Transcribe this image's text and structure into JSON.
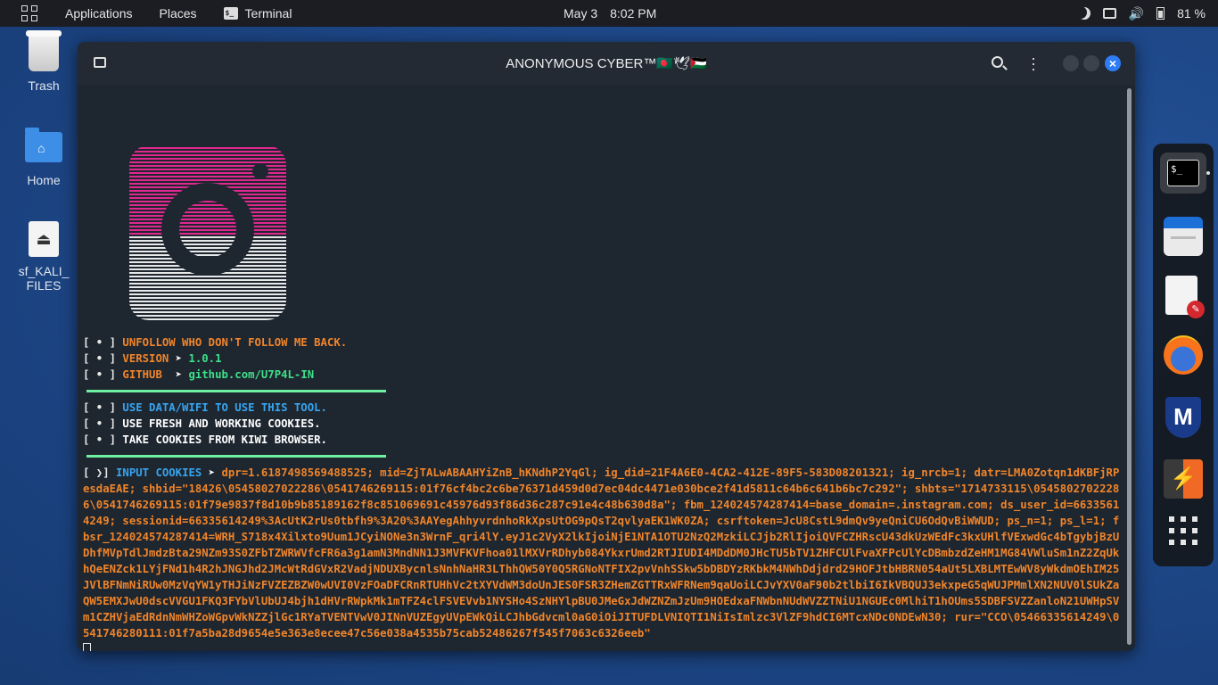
{
  "topbar": {
    "applications": "Applications",
    "places": "Places",
    "terminal": "Terminal",
    "date": "May 3",
    "time": "8:02 PM",
    "battery": "81 %"
  },
  "desktop": {
    "trash": "Trash",
    "home": "Home",
    "sf_line1": "sf_KALI_",
    "sf_line2": "FILES"
  },
  "window": {
    "title": "ANONYMOUS CYBER™🇧🇩🕊🇵🇸"
  },
  "terminal": {
    "info": [
      {
        "prefix": "UNFOLLOW WHO DON'T FOLLOW ME BACK.",
        "value": ""
      },
      {
        "prefix": "VERSION ",
        "value": "1.0.1"
      },
      {
        "prefix": "GITHUB  ",
        "value": "github.com/U7P4L-IN"
      }
    ],
    "notes": [
      "USE DATA/WIFI TO USE THIS TOOL.",
      "USE FRESH AND WORKING COOKIES.",
      "TAKE COOKIES FROM KIWI BROWSER."
    ],
    "input_label": "INPUT COOKIES",
    "cookie_value": "dpr=1.6187498569488525; mid=ZjTALwABAAHYiZnB_hKNdhP2YqGl; ig_did=21F4A6E0-4CA2-412E-89F5-583D08201321; ig_nrcb=1; datr=LMA0Zotqn1dKBFjRPesdaEAE; shbid=\"18426\\05458027022286\\0541746269115:01f76cf4bc2c6be76371d459d0d7ec04dc4471e030bce2f41d5811c64b6c641b6bc7c292\"; shbts=\"1714733115\\05458027022286\\0541746269115:01f79e9837f8d10b9b85189162f8c851069691c45976d93f86d36c287c91e4c48b630d8a\"; fbm_124024574287414=base_domain=.instagram.com; ds_user_id=66335614249; sessionid=66335614249%3AcUtK2rUs0tbfh9%3A20%3AAYegAhhyvrdnhoRkXpsUtOG9pQsT2qvlyaEK1WK0ZA; csrftoken=JcU8CstL9dmQv9yeQniCU6OdQvBiWWUD; ps_n=1; ps_l=1; fbsr_124024574287414=WRH_S718x4Xilxto9Uum1JCyiNONe3n3WrnF_qri4lY.eyJ1c2VyX2lkIjoiNjE1NTA1OTU2NzQ2MzkiLCJjb2RlIjoiQVFCZHRscU43dkUzWEdFc3kxUHlfVExwdGc4bTgybjBzUDhfMVpTdlJmdzBta29NZm93S0ZFbTZWRWVfcFR6a3g1amN3MndNN1J3MVFKVFhoa01lMXVrRDhyb084YkxrUmd2RTJIUDI4MDdDM0JHcTU5bTV1ZHFCUlFvaXFPcUlYcDBmbzdZeHM1MG84VWluSm1nZ2ZqUkhQeENZck1LYjFNd1h4R2hJNGJhd2JMcWtRdGVxR2VadjNDUXBycnlsNnhNaHR3LThhQW50Y0Q5RGNoNTFIX2pvVnhSSkw5bDBDYzRKbkM4NWhDdjdrd29HOFJtbHBRN054aUt5LXBLMTEwWV8yWkdmOEhIM25JVlBFNmNiRUw0MzVqYW1yTHJiNzFVZEZBZW0wUVI0VzFOaDFCRnRTUHhVc2tXYVdWM3doUnJES0FSR3ZHemZGTTRxWFRNem9qaUoiLCJvYXV0aF90b2tlbiI6IkVBQUJ3ekxpeG5qWUJPMmlXN2NUV0lSUkZaQW5EMXJwU0dscVVGU1FKQ3FYbVlUbUJ4bjh1dHVrRWpkMk1mTFZ4clFSVEVvb1NYSHo4SzNHYlpBU0JMeGxJdWZNZmJzUm9HOEdxaFNWbnNUdWVZZTNiU1NGUEc0MlhiT1hOUms5SDBFSVZZanloN21UWHpSVm1CZHVjaEdRdnNmWHZoWGpvWkNZZjlGc1RYaTVENTVwV0JINnVUZEgyUVpEWkQiLCJhbGdvcml0aG0iOiJITUFDLVNIQTI1NiIsImlzc3VlZF9hdCI6MTcxNDc0NDEwN30; rur=\"CCO\\05466335614249\\0541746280111:01f7a5ba28d9654e5e363e8ecee47c56e038a4535b75cab52486267f545f7063c6326eeb\""
  },
  "colors": {
    "orange": "#f0852a",
    "green": "#3ee08a",
    "blue": "#37a5ef",
    "close_button": "#2e7cf6"
  },
  "dock": {
    "icons": [
      "terminal-icon",
      "files-icon",
      "text-editor-icon",
      "firefox-icon",
      "metasploit-icon",
      "burpsuite-icon",
      "show-apps-icon"
    ]
  }
}
